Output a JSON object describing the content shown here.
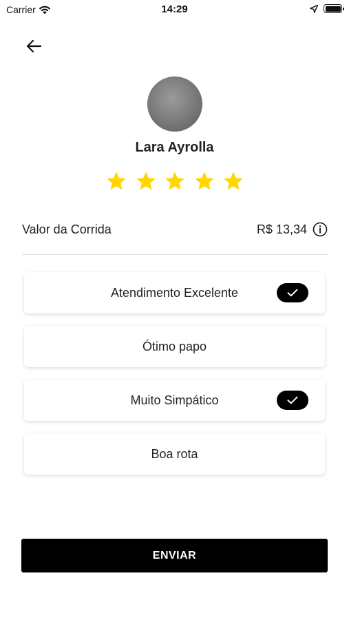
{
  "status_bar": {
    "carrier": "Carrier",
    "time": "14:29",
    "icons": [
      "wifi-icon",
      "location-arrow-icon",
      "battery-icon"
    ]
  },
  "header": {
    "back_icon": "arrow-left-icon"
  },
  "driver": {
    "name": "Lara Ayrolla"
  },
  "rating": {
    "value": 5,
    "max": 5,
    "star_color": "#ffd600"
  },
  "fare": {
    "label": "Valor da Corrida",
    "value": "R$ 13,34",
    "icon": "info-icon"
  },
  "compliments": [
    {
      "label": "Atendimento Excelente",
      "selected": true
    },
    {
      "label": "Ótimo papo",
      "selected": false
    },
    {
      "label": "Muito Simpático",
      "selected": true
    },
    {
      "label": "Boa rota",
      "selected": false
    }
  ],
  "submit": {
    "label": "ENVIAR"
  },
  "colors": {
    "primary": "#000000",
    "background": "#ffffff",
    "star": "#ffd600"
  }
}
